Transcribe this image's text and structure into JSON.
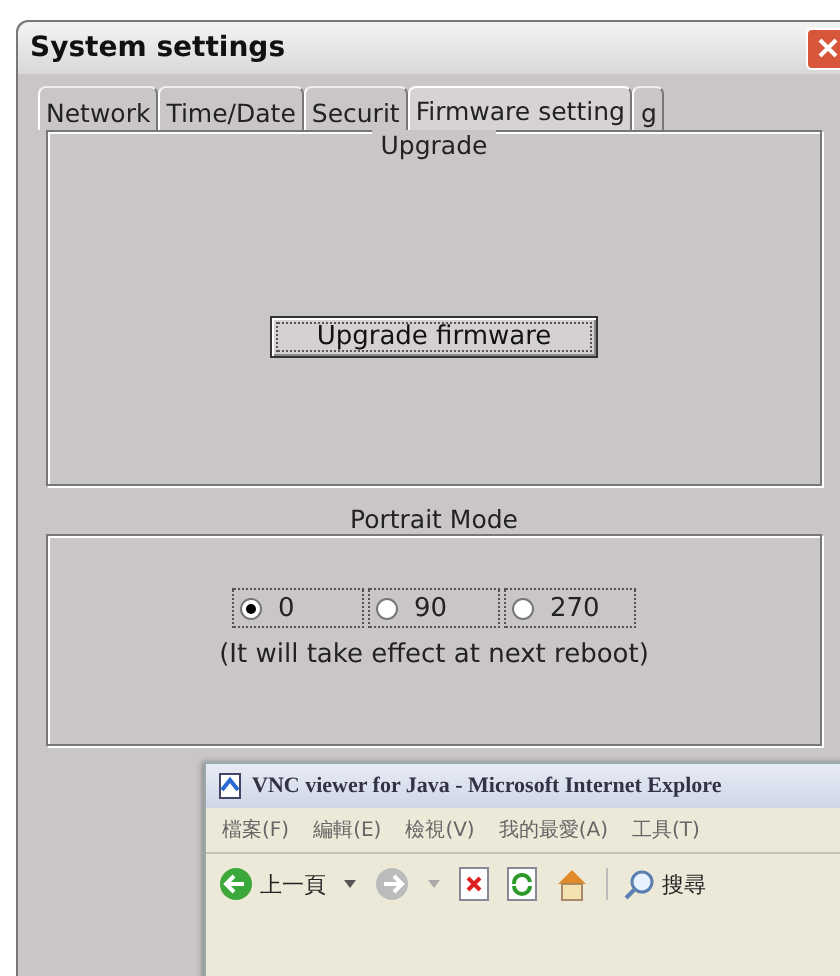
{
  "window": {
    "title": "System settings"
  },
  "tabs": [
    {
      "label": "Network",
      "selected": false
    },
    {
      "label": "Time/Date",
      "selected": false
    },
    {
      "label": "Securit",
      "selected": false
    },
    {
      "label": "Firmware setting",
      "selected": true
    },
    {
      "label": "g",
      "selected": false
    }
  ],
  "upgrade": {
    "title": "Upgrade",
    "button": "Upgrade firmware"
  },
  "portrait": {
    "title": "Portrait Mode",
    "options": [
      {
        "label": "0",
        "selected": true
      },
      {
        "label": "90",
        "selected": false
      },
      {
        "label": "270",
        "selected": false
      }
    ],
    "note": "(It will take effect at next reboot)"
  },
  "browser": {
    "title": "VNC viewer for Java - Microsoft Internet Explore",
    "menu": [
      "檔案(F)",
      "編輯(E)",
      "檢視(V)",
      "我的最愛(A)",
      "工具(T)"
    ],
    "back": "上一頁",
    "search": "搜尋"
  }
}
